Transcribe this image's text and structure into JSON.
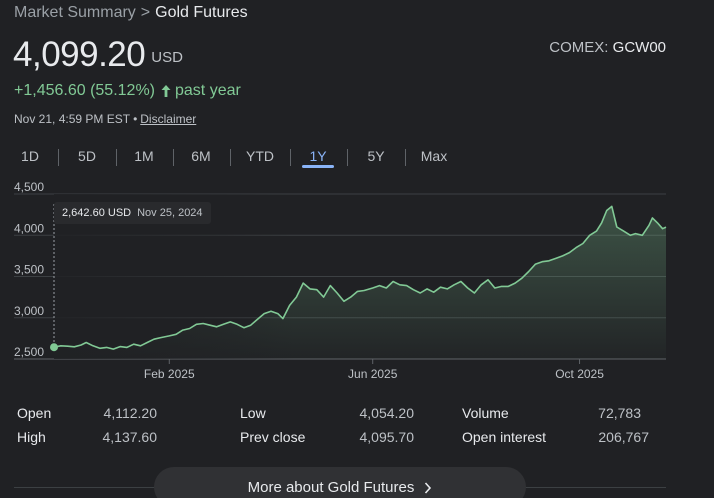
{
  "breadcrumb": {
    "parent": "Market Summary",
    "separator": ">",
    "current": "Gold Futures"
  },
  "quote": {
    "price": "4,099.20",
    "currency": "USD",
    "change": "+1,456.60 (55.12%)",
    "change_period": "past year"
  },
  "exchange": {
    "name": "COMEX:",
    "ticker": "GCW00"
  },
  "timestamp": {
    "time": "Nov 21, 4:59 PM EST",
    "separator": "•",
    "disclaimer": "Disclaimer"
  },
  "range_tabs": [
    {
      "label": "1D",
      "active": false
    },
    {
      "label": "5D",
      "active": false
    },
    {
      "label": "1M",
      "active": false
    },
    {
      "label": "6M",
      "active": false
    },
    {
      "label": "YTD",
      "active": false
    },
    {
      "label": "1Y",
      "active": true
    },
    {
      "label": "5Y",
      "active": false
    },
    {
      "label": "Max",
      "active": false
    }
  ],
  "tooltip": {
    "value": "2,642.60 USD",
    "date": "Nov 25, 2024"
  },
  "chart_data": {
    "type": "area",
    "ylim": [
      2500,
      4500
    ],
    "yticks": [
      {
        "value": 2500,
        "label": "2,500"
      },
      {
        "value": 3000,
        "label": "3,000"
      },
      {
        "value": 3500,
        "label": "3,500"
      },
      {
        "value": 4000,
        "label": "4,000"
      },
      {
        "value": 4500,
        "label": "4,500"
      }
    ],
    "xlim": [
      "2024-11-25",
      "2025-11-21"
    ],
    "xticks": [
      {
        "date": "2025-02-01",
        "label": "Feb 2025"
      },
      {
        "date": "2025-06-01",
        "label": "Jun 2025"
      },
      {
        "date": "2025-10-01",
        "label": "Oct 2025"
      }
    ],
    "line_color": "#81c995",
    "grid": true,
    "points": [
      [
        "2024-11-25",
        2643
      ],
      [
        "2024-11-29",
        2660
      ],
      [
        "2024-12-03",
        2655
      ],
      [
        "2024-12-07",
        2648
      ],
      [
        "2024-12-11",
        2670
      ],
      [
        "2024-12-14",
        2700
      ],
      [
        "2024-12-18",
        2660
      ],
      [
        "2024-12-22",
        2630
      ],
      [
        "2024-12-26",
        2640
      ],
      [
        "2024-12-30",
        2620
      ],
      [
        "2025-01-03",
        2650
      ],
      [
        "2025-01-07",
        2640
      ],
      [
        "2025-01-11",
        2680
      ],
      [
        "2025-01-15",
        2660
      ],
      [
        "2025-01-19",
        2700
      ],
      [
        "2025-01-23",
        2740
      ],
      [
        "2025-01-27",
        2760
      ],
      [
        "2025-02-01",
        2780
      ],
      [
        "2025-02-05",
        2800
      ],
      [
        "2025-02-09",
        2850
      ],
      [
        "2025-02-13",
        2870
      ],
      [
        "2025-02-17",
        2920
      ],
      [
        "2025-02-21",
        2930
      ],
      [
        "2025-02-25",
        2910
      ],
      [
        "2025-03-01",
        2890
      ],
      [
        "2025-03-05",
        2920
      ],
      [
        "2025-03-09",
        2950
      ],
      [
        "2025-03-13",
        2920
      ],
      [
        "2025-03-17",
        2880
      ],
      [
        "2025-03-21",
        2910
      ],
      [
        "2025-03-25",
        2980
      ],
      [
        "2025-03-29",
        3050
      ],
      [
        "2025-04-02",
        3080
      ],
      [
        "2025-04-06",
        3050
      ],
      [
        "2025-04-09",
        2990
      ],
      [
        "2025-04-13",
        3150
      ],
      [
        "2025-04-17",
        3250
      ],
      [
        "2025-04-21",
        3420
      ],
      [
        "2025-04-25",
        3350
      ],
      [
        "2025-04-29",
        3340
      ],
      [
        "2025-05-03",
        3250
      ],
      [
        "2025-05-07",
        3390
      ],
      [
        "2025-05-11",
        3300
      ],
      [
        "2025-05-15",
        3200
      ],
      [
        "2025-05-19",
        3250
      ],
      [
        "2025-05-23",
        3320
      ],
      [
        "2025-05-27",
        3330
      ],
      [
        "2025-06-01",
        3360
      ],
      [
        "2025-06-05",
        3390
      ],
      [
        "2025-06-09",
        3360
      ],
      [
        "2025-06-13",
        3440
      ],
      [
        "2025-06-17",
        3400
      ],
      [
        "2025-06-21",
        3390
      ],
      [
        "2025-06-25",
        3340
      ],
      [
        "2025-06-29",
        3300
      ],
      [
        "2025-07-03",
        3350
      ],
      [
        "2025-07-07",
        3310
      ],
      [
        "2025-07-11",
        3370
      ],
      [
        "2025-07-15",
        3350
      ],
      [
        "2025-07-19",
        3400
      ],
      [
        "2025-07-23",
        3440
      ],
      [
        "2025-07-27",
        3360
      ],
      [
        "2025-07-31",
        3300
      ],
      [
        "2025-08-04",
        3400
      ],
      [
        "2025-08-08",
        3460
      ],
      [
        "2025-08-12",
        3360
      ],
      [
        "2025-08-16",
        3380
      ],
      [
        "2025-08-20",
        3380
      ],
      [
        "2025-08-24",
        3420
      ],
      [
        "2025-08-28",
        3480
      ],
      [
        "2025-09-01",
        3560
      ],
      [
        "2025-09-05",
        3650
      ],
      [
        "2025-09-09",
        3680
      ],
      [
        "2025-09-13",
        3690
      ],
      [
        "2025-09-17",
        3720
      ],
      [
        "2025-09-21",
        3750
      ],
      [
        "2025-09-25",
        3790
      ],
      [
        "2025-09-29",
        3850
      ],
      [
        "2025-10-03",
        3900
      ],
      [
        "2025-10-07",
        4000
      ],
      [
        "2025-10-11",
        4050
      ],
      [
        "2025-10-14",
        4150
      ],
      [
        "2025-10-17",
        4300
      ],
      [
        "2025-10-20",
        4350
      ],
      [
        "2025-10-23",
        4100
      ],
      [
        "2025-10-27",
        4050
      ],
      [
        "2025-10-31",
        4000
      ],
      [
        "2025-11-03",
        4020
      ],
      [
        "2025-11-07",
        4000
      ],
      [
        "2025-11-11",
        4120
      ],
      [
        "2025-11-13",
        4210
      ],
      [
        "2025-11-16",
        4150
      ],
      [
        "2025-11-19",
        4080
      ],
      [
        "2025-11-21",
        4099
      ]
    ]
  },
  "stats": [
    {
      "label": "Open",
      "value": "4,112.20"
    },
    {
      "label": "High",
      "value": "4,137.60"
    },
    {
      "label": "Low",
      "value": "4,054.20"
    },
    {
      "label": "Prev close",
      "value": "4,095.70"
    },
    {
      "label": "Volume",
      "value": "72,783"
    },
    {
      "label": "Open interest",
      "value": "206,767"
    }
  ],
  "more_button": {
    "label": "More about Gold Futures"
  },
  "colors": {
    "background": "#202124",
    "positive": "#81c995",
    "accent": "#8ab4f8",
    "grid": "#3c4043"
  },
  "icons": {
    "change_arrow": "arrow-up-icon",
    "more_chevron": "chevron-right-icon"
  }
}
